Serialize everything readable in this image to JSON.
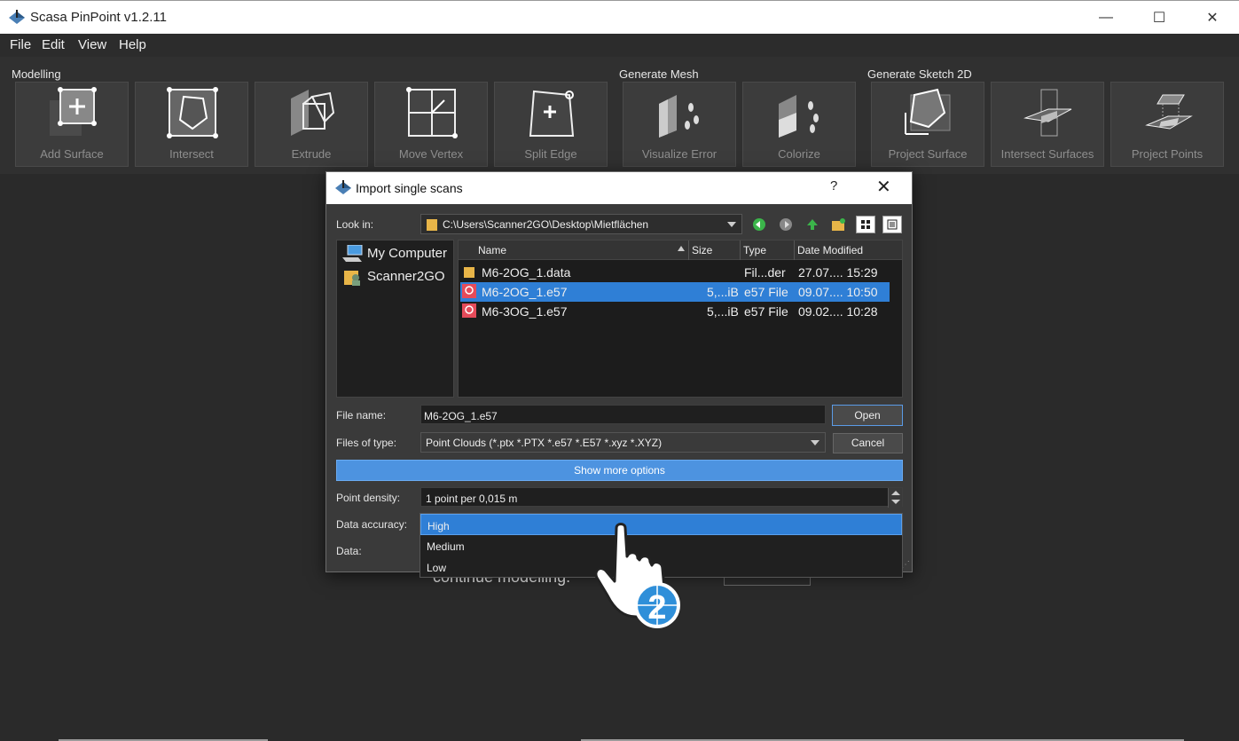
{
  "app": {
    "title": "Scasa PinPoint v1.2.11"
  },
  "window_controls": {
    "minimize": "—",
    "maximize": "☐",
    "close": "✕"
  },
  "menu": [
    "File",
    "Edit",
    "View",
    "Help"
  ],
  "toolbar": {
    "groups": {
      "modelling": "Modelling",
      "generate_mesh": "Generate Mesh",
      "generate_sketch": "Generate Sketch 2D"
    },
    "tools": [
      {
        "label": "Add Surface",
        "icon": "add-surface-icon"
      },
      {
        "label": "Intersect",
        "icon": "intersect-icon"
      },
      {
        "label": "Extrude",
        "icon": "extrude-icon"
      },
      {
        "label": "Move Vertex",
        "icon": "move-vertex-icon"
      },
      {
        "label": "Split Edge",
        "icon": "split-edge-icon"
      },
      {
        "label": "Visualize Error",
        "icon": "visualize-error-icon"
      },
      {
        "label": "Colorize",
        "icon": "colorize-icon"
      },
      {
        "label": "Project Surface",
        "icon": "project-surface-icon"
      },
      {
        "label": "Intersect Surfaces",
        "icon": "intersect-surfaces-icon"
      },
      {
        "label": "Project Points",
        "icon": "project-points-icon"
      }
    ]
  },
  "dialog": {
    "title": "Import single scans",
    "help": "?",
    "close": "✕",
    "look_in_label": "Look in:",
    "look_in_value": "C:\\Users\\Scanner2GO\\Desktop\\Mietflächen",
    "sidebar": [
      {
        "label": "My Computer",
        "icon": "computer-icon"
      },
      {
        "label": "Scanner2GO",
        "icon": "user-folder-icon"
      }
    ],
    "columns": {
      "name": "Name",
      "size": "Size",
      "type": "Type",
      "date": "Date Modified"
    },
    "files": [
      {
        "name": "M6-2OG_1.data",
        "size": "",
        "type": "Fil...der",
        "date": "27.07.... 15:29",
        "icon": "folder-icon",
        "selected": false
      },
      {
        "name": "M6-2OG_1.e57",
        "size": "5,...iB",
        "type": "e57 File",
        "date": "09.07.... 10:50",
        "icon": "e57-file-icon",
        "selected": true
      },
      {
        "name": "M6-3OG_1.e57",
        "size": "5,...iB",
        "type": "e57 File",
        "date": "09.02.... 10:28",
        "icon": "e57-file-icon",
        "selected": false
      }
    ],
    "file_name_label": "File name:",
    "file_name_value": "M6-2OG_1.e57",
    "files_of_type_label": "Files of type:",
    "files_of_type_value": "Point Clouds (*.ptx *.PTX *.e57 *.E57 *.xyz *.XYZ)",
    "open_button": "Open",
    "cancel_button": "Cancel",
    "more_options": "Show more options",
    "point_density_label": "Point density:",
    "point_density_value": "1 point per 0,015 m",
    "data_accuracy_label": "Data accuracy:",
    "data_label": "Data:",
    "accuracy_options": [
      "High",
      "Medium",
      "Low"
    ],
    "accuracy_selected": "High"
  },
  "background": {
    "partial_text": "continue modelling."
  },
  "overlay": {
    "step_number": "2"
  }
}
